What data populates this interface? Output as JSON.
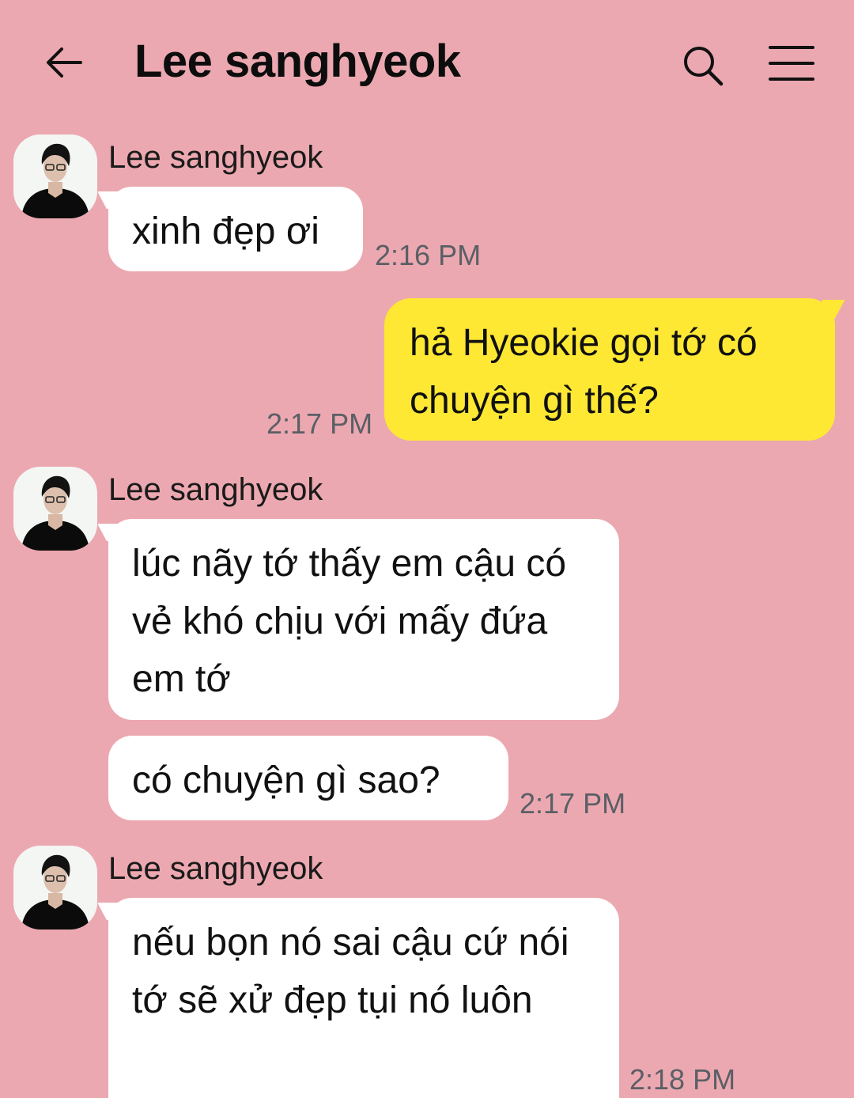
{
  "header": {
    "title": "Lee sanghyeok",
    "back_icon": "arrow-left-icon",
    "search_icon": "search-icon",
    "menu_icon": "hamburger-menu-icon"
  },
  "colors": {
    "background": "#eca8b0",
    "incoming_bubble": "#ffffff",
    "outgoing_bubble": "#fee833",
    "timestamp": "#5a5f66"
  },
  "messages": [
    {
      "direction": "incoming",
      "sender": "Lee sanghyeok",
      "text": "xinh đẹp ơi",
      "time": "2:16 PM"
    },
    {
      "direction": "outgoing",
      "text": "hả Hyeokie gọi tớ có chuyện gì thế?",
      "time": "2:17 PM"
    },
    {
      "direction": "incoming",
      "sender": "Lee sanghyeok",
      "text": "lúc nãy tớ thấy em cậu có vẻ khó chịu với mấy đứa em tớ"
    },
    {
      "direction": "incoming",
      "text": "có chuyện gì sao?",
      "time": "2:17 PM"
    },
    {
      "direction": "incoming",
      "sender": "Lee sanghyeok",
      "text": "nếu bọn nó sai cậu cứ nói tớ sẽ xử đẹp tụi nó luôn",
      "time": "2:18 PM"
    }
  ]
}
